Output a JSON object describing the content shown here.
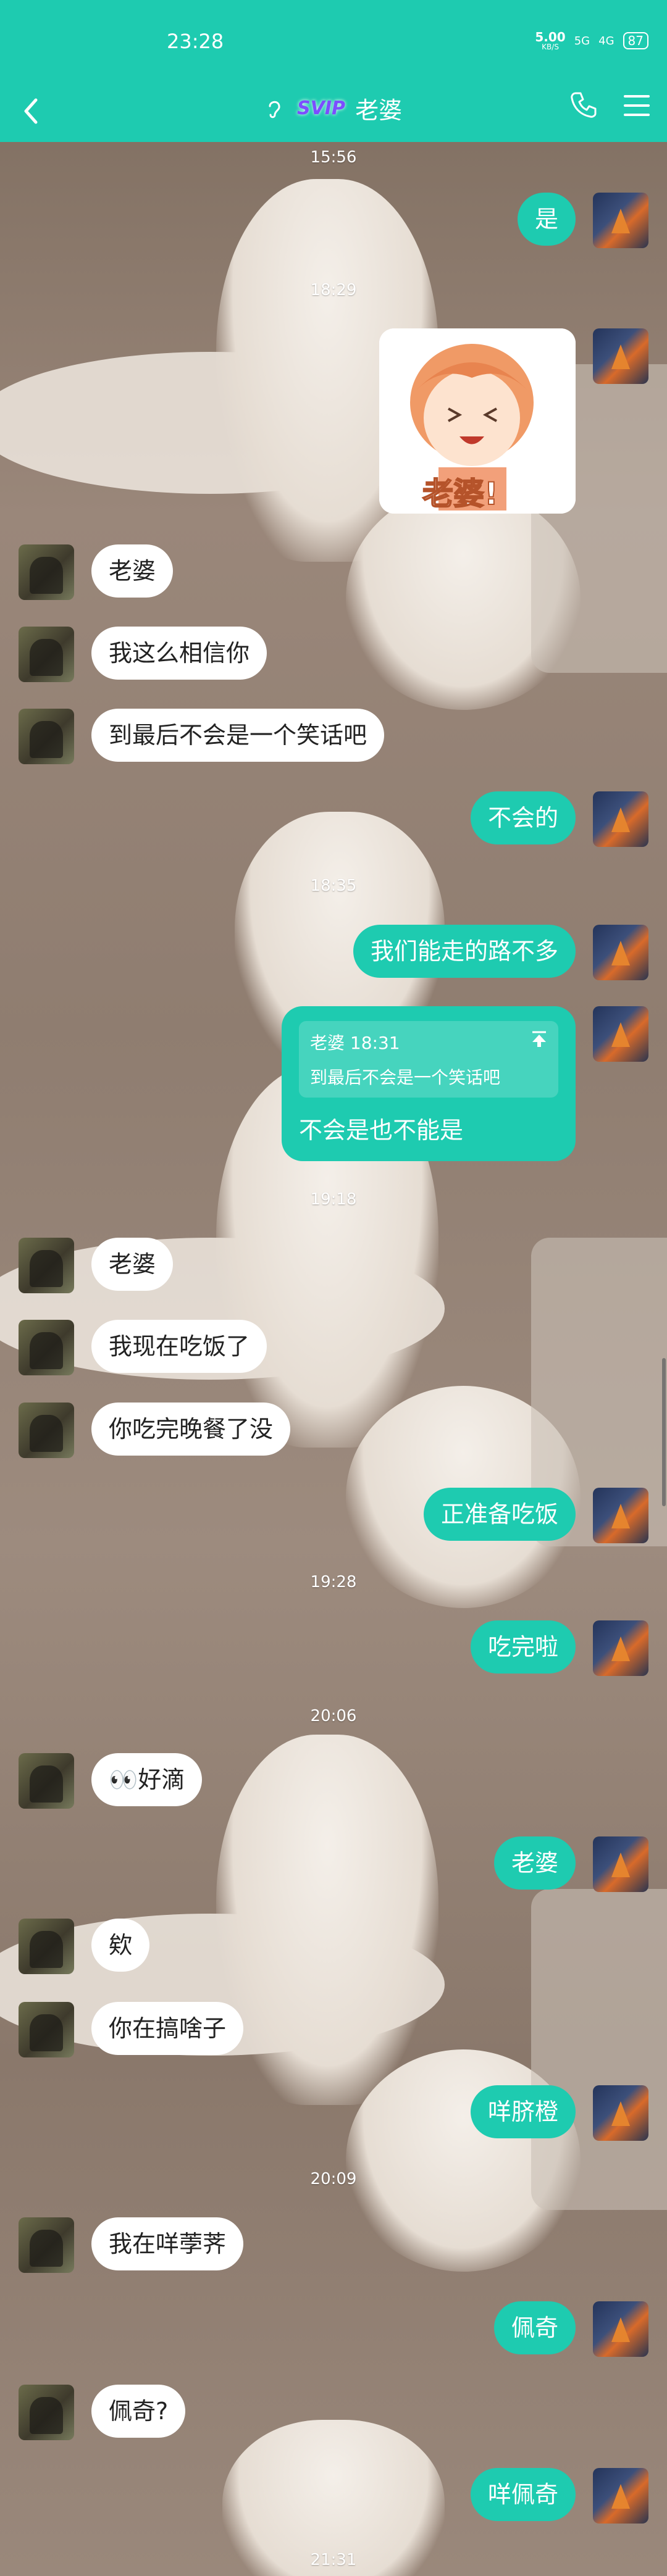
{
  "status": {
    "time": "23:28",
    "speed_value": "5.00",
    "speed_unit": "KB/S",
    "net1": "5G",
    "net2": "4G",
    "battery": "87"
  },
  "header": {
    "vip_badge": "SVIP",
    "title": "老婆"
  },
  "messages": [
    {
      "kind": "time",
      "text": "15:56"
    },
    {
      "kind": "out",
      "text": "是"
    },
    {
      "kind": "time",
      "text": "18:29"
    },
    {
      "kind": "sticker",
      "caption": "老婆!"
    },
    {
      "kind": "in",
      "text": "老婆"
    },
    {
      "kind": "in",
      "text": "我这么相信你"
    },
    {
      "kind": "in",
      "text": "到最后不会是一个笑话吧"
    },
    {
      "kind": "out",
      "text": "不会的"
    },
    {
      "kind": "time",
      "text": "18:35"
    },
    {
      "kind": "out",
      "text": "我们能走的路不多"
    },
    {
      "kind": "quote",
      "quote_head": "老婆 18:31",
      "quote_body": "到最后不会是一个笑话吧",
      "text": "不会是也不能是"
    },
    {
      "kind": "time",
      "text": "19:18"
    },
    {
      "kind": "in",
      "text": "老婆"
    },
    {
      "kind": "in",
      "text": "我现在吃饭了"
    },
    {
      "kind": "in",
      "text": "你吃完晚餐了没"
    },
    {
      "kind": "out",
      "text": "正准备吃饭"
    },
    {
      "kind": "time",
      "text": "19:28"
    },
    {
      "kind": "out",
      "text": "吃完啦"
    },
    {
      "kind": "time",
      "text": "20:06"
    },
    {
      "kind": "in",
      "text": "好滴",
      "prefix": "👀"
    },
    {
      "kind": "out",
      "text": "老婆"
    },
    {
      "kind": "in",
      "text": "欸"
    },
    {
      "kind": "in",
      "text": "你在搞啥子"
    },
    {
      "kind": "out",
      "text": "咩脐橙"
    },
    {
      "kind": "time",
      "text": "20:09"
    },
    {
      "kind": "in",
      "text": "我在咩荸荠"
    },
    {
      "kind": "out",
      "text": "佩奇"
    },
    {
      "kind": "in",
      "text": "佩奇?"
    },
    {
      "kind": "out",
      "text": "咩佩奇"
    },
    {
      "kind": "time",
      "text": "21:31"
    }
  ]
}
